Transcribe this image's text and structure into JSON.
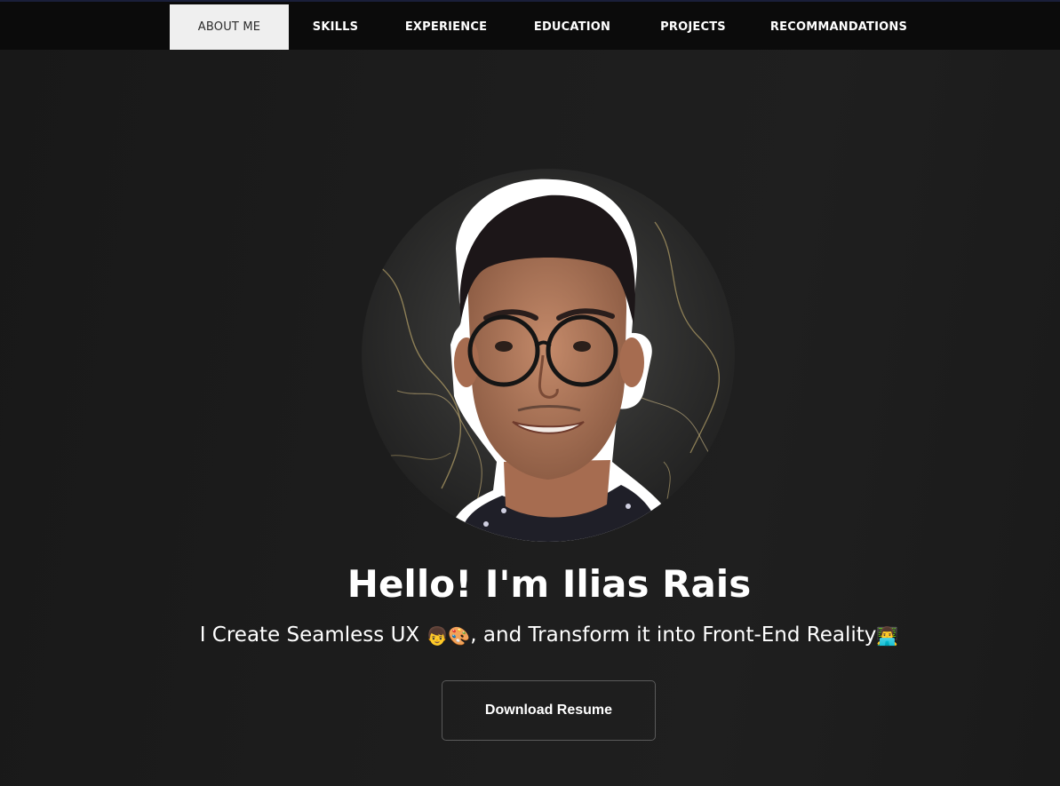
{
  "nav": {
    "items": [
      {
        "label": "ABOUT ME",
        "active": true
      },
      {
        "label": "SKILLS",
        "active": false
      },
      {
        "label": "EXPERIENCE",
        "active": false
      },
      {
        "label": "EDUCATION",
        "active": false
      },
      {
        "label": "PROJECTS",
        "active": false
      },
      {
        "label": "RECOMMANDATIONS",
        "active": false
      }
    ]
  },
  "hero": {
    "greeting": "Hello! I'm Ilias Rais",
    "tagline_part1": "I Create Seamless UX ",
    "tagline_emoji1": "👦",
    "tagline_emoji2": "🎨",
    "tagline_part2": ", and Transform it into Front-End Reality",
    "tagline_emoji3": "👨‍💻",
    "cta_label": "Download Resume"
  },
  "colors": {
    "background": "#1c1c1c",
    "navbar": "#0b0b0b",
    "nav_active_bg": "#efefef",
    "text": "#ffffff"
  },
  "icons": {
    "avatar": "profile-photo-marble-circle"
  }
}
